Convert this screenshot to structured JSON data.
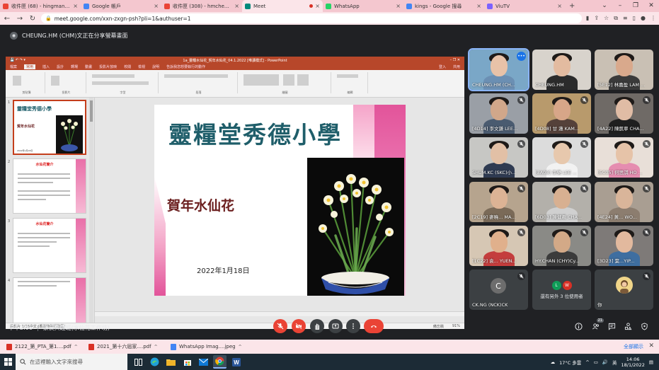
{
  "browser": {
    "tabs": [
      {
        "title": "收件匣 (68) - hingmankaren@...",
        "favicon_color": "#ea4335",
        "active": false,
        "recording": false
      },
      {
        "title": "Google 帳戶",
        "favicon_color": "#4285f4",
        "active": false,
        "recording": false
      },
      {
        "title": "收件匣 (308) - hmcheung@lc...",
        "favicon_color": "#ea4335",
        "active": false,
        "recording": false
      },
      {
        "title": "Meet",
        "favicon_color": "#00897b",
        "active": true,
        "recording": true
      },
      {
        "title": "WhatsApp",
        "favicon_color": "#25d366",
        "active": false,
        "recording": false
      },
      {
        "title": "kings - Google 搜尋",
        "favicon_color": "#4285f4",
        "active": false,
        "recording": false
      },
      {
        "title": "ViuTV",
        "favicon_color": "#7b61ff",
        "active": false,
        "recording": false
      }
    ],
    "url": "meet.google.com/xxn-zxgn-psh?pli=1&authuser=1"
  },
  "meet": {
    "presenter_text": "CHEUNG.HM (CHM)文正在分享螢幕畫面",
    "time": "下午2:06",
    "meeting_title": "家長興趣班(水仙花工作坊)",
    "people_count": "21"
  },
  "ppt": {
    "window_title": "1a_靈糧水仙花_賀年水仙花_04.1.2022 [唯讀模式] - PowerPoint",
    "menu": [
      "檔案",
      "常用",
      "插入",
      "設計",
      "轉場",
      "動畫",
      "投影片放映",
      "校閱",
      "檢視",
      "說明",
      "告訴我您想要執行的動作"
    ],
    "share_labels": [
      "登入",
      "共用"
    ],
    "ribbon_groups": [
      "剪貼簿",
      "投影片",
      "字型",
      "段落",
      "繪圖",
      "編輯"
    ],
    "thumbnails": [
      {
        "num": "1",
        "title": "靈糧堂秀德小學",
        "sub": "賀年水仙花",
        "date": "2022年1月18日"
      },
      {
        "num": "2",
        "title": "水仙花簡介"
      },
      {
        "num": "3",
        "title": "水仙花簡介"
      },
      {
        "num": "4"
      }
    ],
    "slide": {
      "title": "靈糧堂秀德小學",
      "subtitle": "賀年水仙花",
      "date": "2022年1月18日"
    },
    "status_left": "投影片 1/26",
    "status_lang": "中文 (香港特別行政區)",
    "status_right": "備忘稿",
    "zoom": "91%"
  },
  "participants": [
    {
      "name": "CHEUNG.HM (CH...",
      "speaking": true,
      "muted": false,
      "bg": "#7aa7c7",
      "face": "#e8c2a8",
      "shirt": "#6b8fb3"
    },
    {
      "name": "CHEUNG.HM",
      "speaking": false,
      "muted": false,
      "bg": "#d8d3cc",
      "face": "#e3bba0",
      "shirt": "#2b2b2b"
    },
    {
      "name": "[5E12] 林嘉盈 LAM ...",
      "speaking": false,
      "muted": false,
      "bg": "#c9c0b4",
      "face": "#d9a98c",
      "shirt": "#3a3a3a"
    },
    {
      "name": "[4D14] 李文謙 LEE...",
      "speaking": false,
      "muted": true,
      "bg": "#9a9fa6",
      "face": "#d1a78a",
      "shirt": "#4a5b70"
    },
    {
      "name": "[4D08] 甘 蓮 KAM...",
      "speaking": false,
      "muted": true,
      "bg": "#b89a6c",
      "face": "#d7a688",
      "shirt": "#55413a"
    },
    {
      "name": "[4A22] 陳凱寧 CHA...",
      "speaking": false,
      "muted": true,
      "bg": "#6f6a66",
      "face": "#e0bca5",
      "shirt": "#1f1f1f"
    },
    {
      "name": "SHUM.KC (SKC)小...",
      "speaking": false,
      "muted": true,
      "bg": "#c7c7c4",
      "face": "#e2c0a6",
      "shirt": "#2f3b52"
    },
    {
      "name": "[3A08] 李樂 LEE ...",
      "speaking": false,
      "muted": true,
      "bg": "#dcdcdc",
      "face": "#e7c8ad",
      "shirt": "#f2f2f2"
    },
    {
      "name": "[5C05] 何思淇 HO ...",
      "speaking": false,
      "muted": true,
      "bg": "#e8dfd8",
      "face": "#e6c3a8",
      "shirt": "#e58db0"
    },
    {
      "name": "[2C19] 麥曉... MA...",
      "speaking": false,
      "muted": true,
      "bg": "#b6a48e",
      "face": "#dcb395",
      "shirt": "#7a6a58"
    },
    {
      "name": "[6D03] 陳健羲 CHA...",
      "speaking": false,
      "muted": true,
      "bg": "#b3b0aa",
      "face": "#d8b091",
      "shirt": "#d0d0d0"
    },
    {
      "name": "[4E24] 黃... WO...",
      "speaking": false,
      "muted": true,
      "bg": "#a99e92",
      "face": "#d9b59a",
      "shirt": "#8c7d6f"
    },
    {
      "name": "[1C22] 袁... YUEN...",
      "speaking": false,
      "muted": true,
      "bg": "#d6c7b4",
      "face": "#e0b08c",
      "shirt": "#c43d3d"
    },
    {
      "name": "HY.CHAN (CHY)Cy...",
      "speaking": false,
      "muted": true,
      "bg": "#8a8a86",
      "face": "#d3a987",
      "shirt": "#3b3b3b"
    },
    {
      "name": "[3D23] 葉...YIP...",
      "speaking": false,
      "muted": true,
      "bg": "#7e7a78",
      "face": "#e2b99e",
      "shirt": "#3e6ea0"
    }
  ],
  "bottom_tiles": {
    "ck": {
      "name": "CK.NG (NCK)CK",
      "initial": "C"
    },
    "others": {
      "label": "還有另外 3 位使用者",
      "avatars": [
        {
          "letter": "L",
          "color": "#0f9d58"
        },
        {
          "letter": "W",
          "color": "#d93025"
        }
      ]
    },
    "you": {
      "name": "你"
    }
  },
  "downloads": [
    {
      "name": "2122_第_PTA_第1....pdf",
      "color": "#d93025"
    },
    {
      "name": "2021_第十六屆家....pdf",
      "color": "#d93025"
    },
    {
      "name": "WhatsApp Imag....jpeg",
      "color": "#4285f4"
    }
  ],
  "downloads_showall": "全部顯示",
  "taskbar": {
    "search_placeholder": "在這裡輸入文字來搜尋",
    "weather": "17°C 多雲",
    "ime": "英",
    "time": "14:06",
    "date": "18/1/2022"
  }
}
